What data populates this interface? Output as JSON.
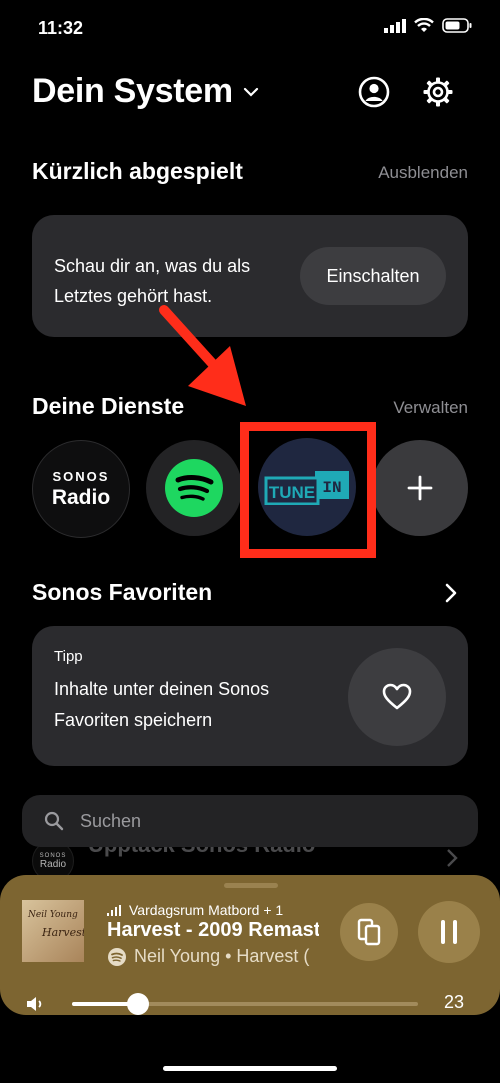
{
  "status": {
    "time": "11:32"
  },
  "header": {
    "title": "Dein System"
  },
  "recent": {
    "title": "Kürzlich abgespielt",
    "hide_label": "Ausblenden",
    "card_text_1": "Schau dir an, was du als",
    "card_text_2": "Letztes gehört hast.",
    "enable_label": "Einschalten"
  },
  "services": {
    "title": "Deine Dienste",
    "manage_label": "Verwalten",
    "sonos_radio_small": "SONOS",
    "sonos_radio_big": "Radio",
    "tunein_part1": "TUNE",
    "tunein_part2": "IN"
  },
  "favorites": {
    "title": "Sonos Favoriten",
    "tip_label": "Tipp",
    "tip_text_1": "Inhalte unter deinen Sonos",
    "tip_text_2": "Favoriten speichern"
  },
  "search": {
    "placeholder": "Suchen"
  },
  "behind": {
    "text": "Upptäck Sonos Radio",
    "logo_small": "SONOS",
    "logo_big": "Radio"
  },
  "player": {
    "room": "Vardagsrum Matbord + 1",
    "track": "Harvest - 2009 Remast",
    "artist": "Neil Young • Harvest (",
    "volume": "23",
    "volume_level": 0.19,
    "album_art_text_1": "Neil Young",
    "album_art_text_2": "Harvest"
  },
  "colors": {
    "accent_red": "#ff2d1a",
    "spotify_green": "#1ed760",
    "tunein_teal": "#1fa9b6",
    "player_bg": "#7d6531"
  }
}
